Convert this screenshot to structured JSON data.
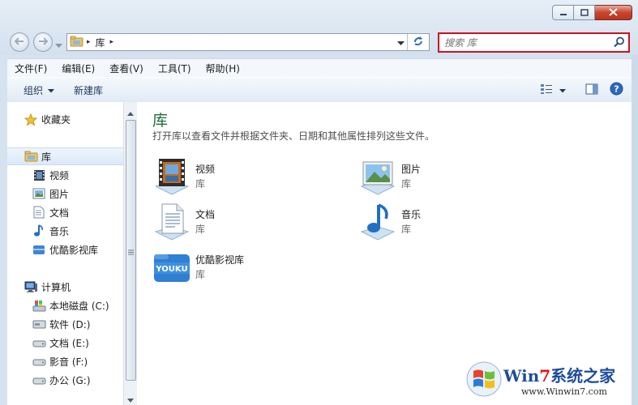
{
  "window": {
    "caption_buttons": [
      "minimize-icon",
      "maximize-icon",
      "close-icon"
    ]
  },
  "address": {
    "path": [
      "库"
    ],
    "separator": "▸"
  },
  "search": {
    "placeholder": "搜索 库"
  },
  "menubar": {
    "items": [
      "文件(F)",
      "编辑(E)",
      "查看(V)",
      "工具(T)",
      "帮助(H)"
    ]
  },
  "commandbar": {
    "organize": "组织",
    "new_library": "新建库"
  },
  "navpane": {
    "favorites": "收藏夹",
    "libraries": "库",
    "library_items": [
      "视频",
      "图片",
      "文档",
      "音乐",
      "优酷影视库"
    ],
    "computer": "计算机",
    "drives": [
      "本地磁盘 (C:)",
      "软件 (D:)",
      "文档 (E:)",
      "影音 (F:)",
      "办公 (G:)"
    ]
  },
  "content": {
    "title": "库",
    "subtitle": "打开库以查看文件并根据文件夹、日期和其他属性排列这些文件。",
    "libraries": [
      {
        "name": "视频",
        "kind": "库",
        "icon": "video-library-icon"
      },
      {
        "name": "图片",
        "kind": "库",
        "icon": "pictures-library-icon"
      },
      {
        "name": "文档",
        "kind": "库",
        "icon": "documents-library-icon"
      },
      {
        "name": "音乐",
        "kind": "库",
        "icon": "music-library-icon"
      },
      {
        "name": "优酷影视库",
        "kind": "库",
        "icon": "youku-library-icon"
      }
    ],
    "youku_badge": "YOUKU"
  },
  "watermark": {
    "brand_a": "Win",
    "brand_b": "7",
    "brand_c": "系统之家",
    "url": "www.Winwin7.com"
  },
  "colors": {
    "search_border": "#d0101e",
    "title_green": "#1e6e3c",
    "close_red": "#c9452e"
  }
}
